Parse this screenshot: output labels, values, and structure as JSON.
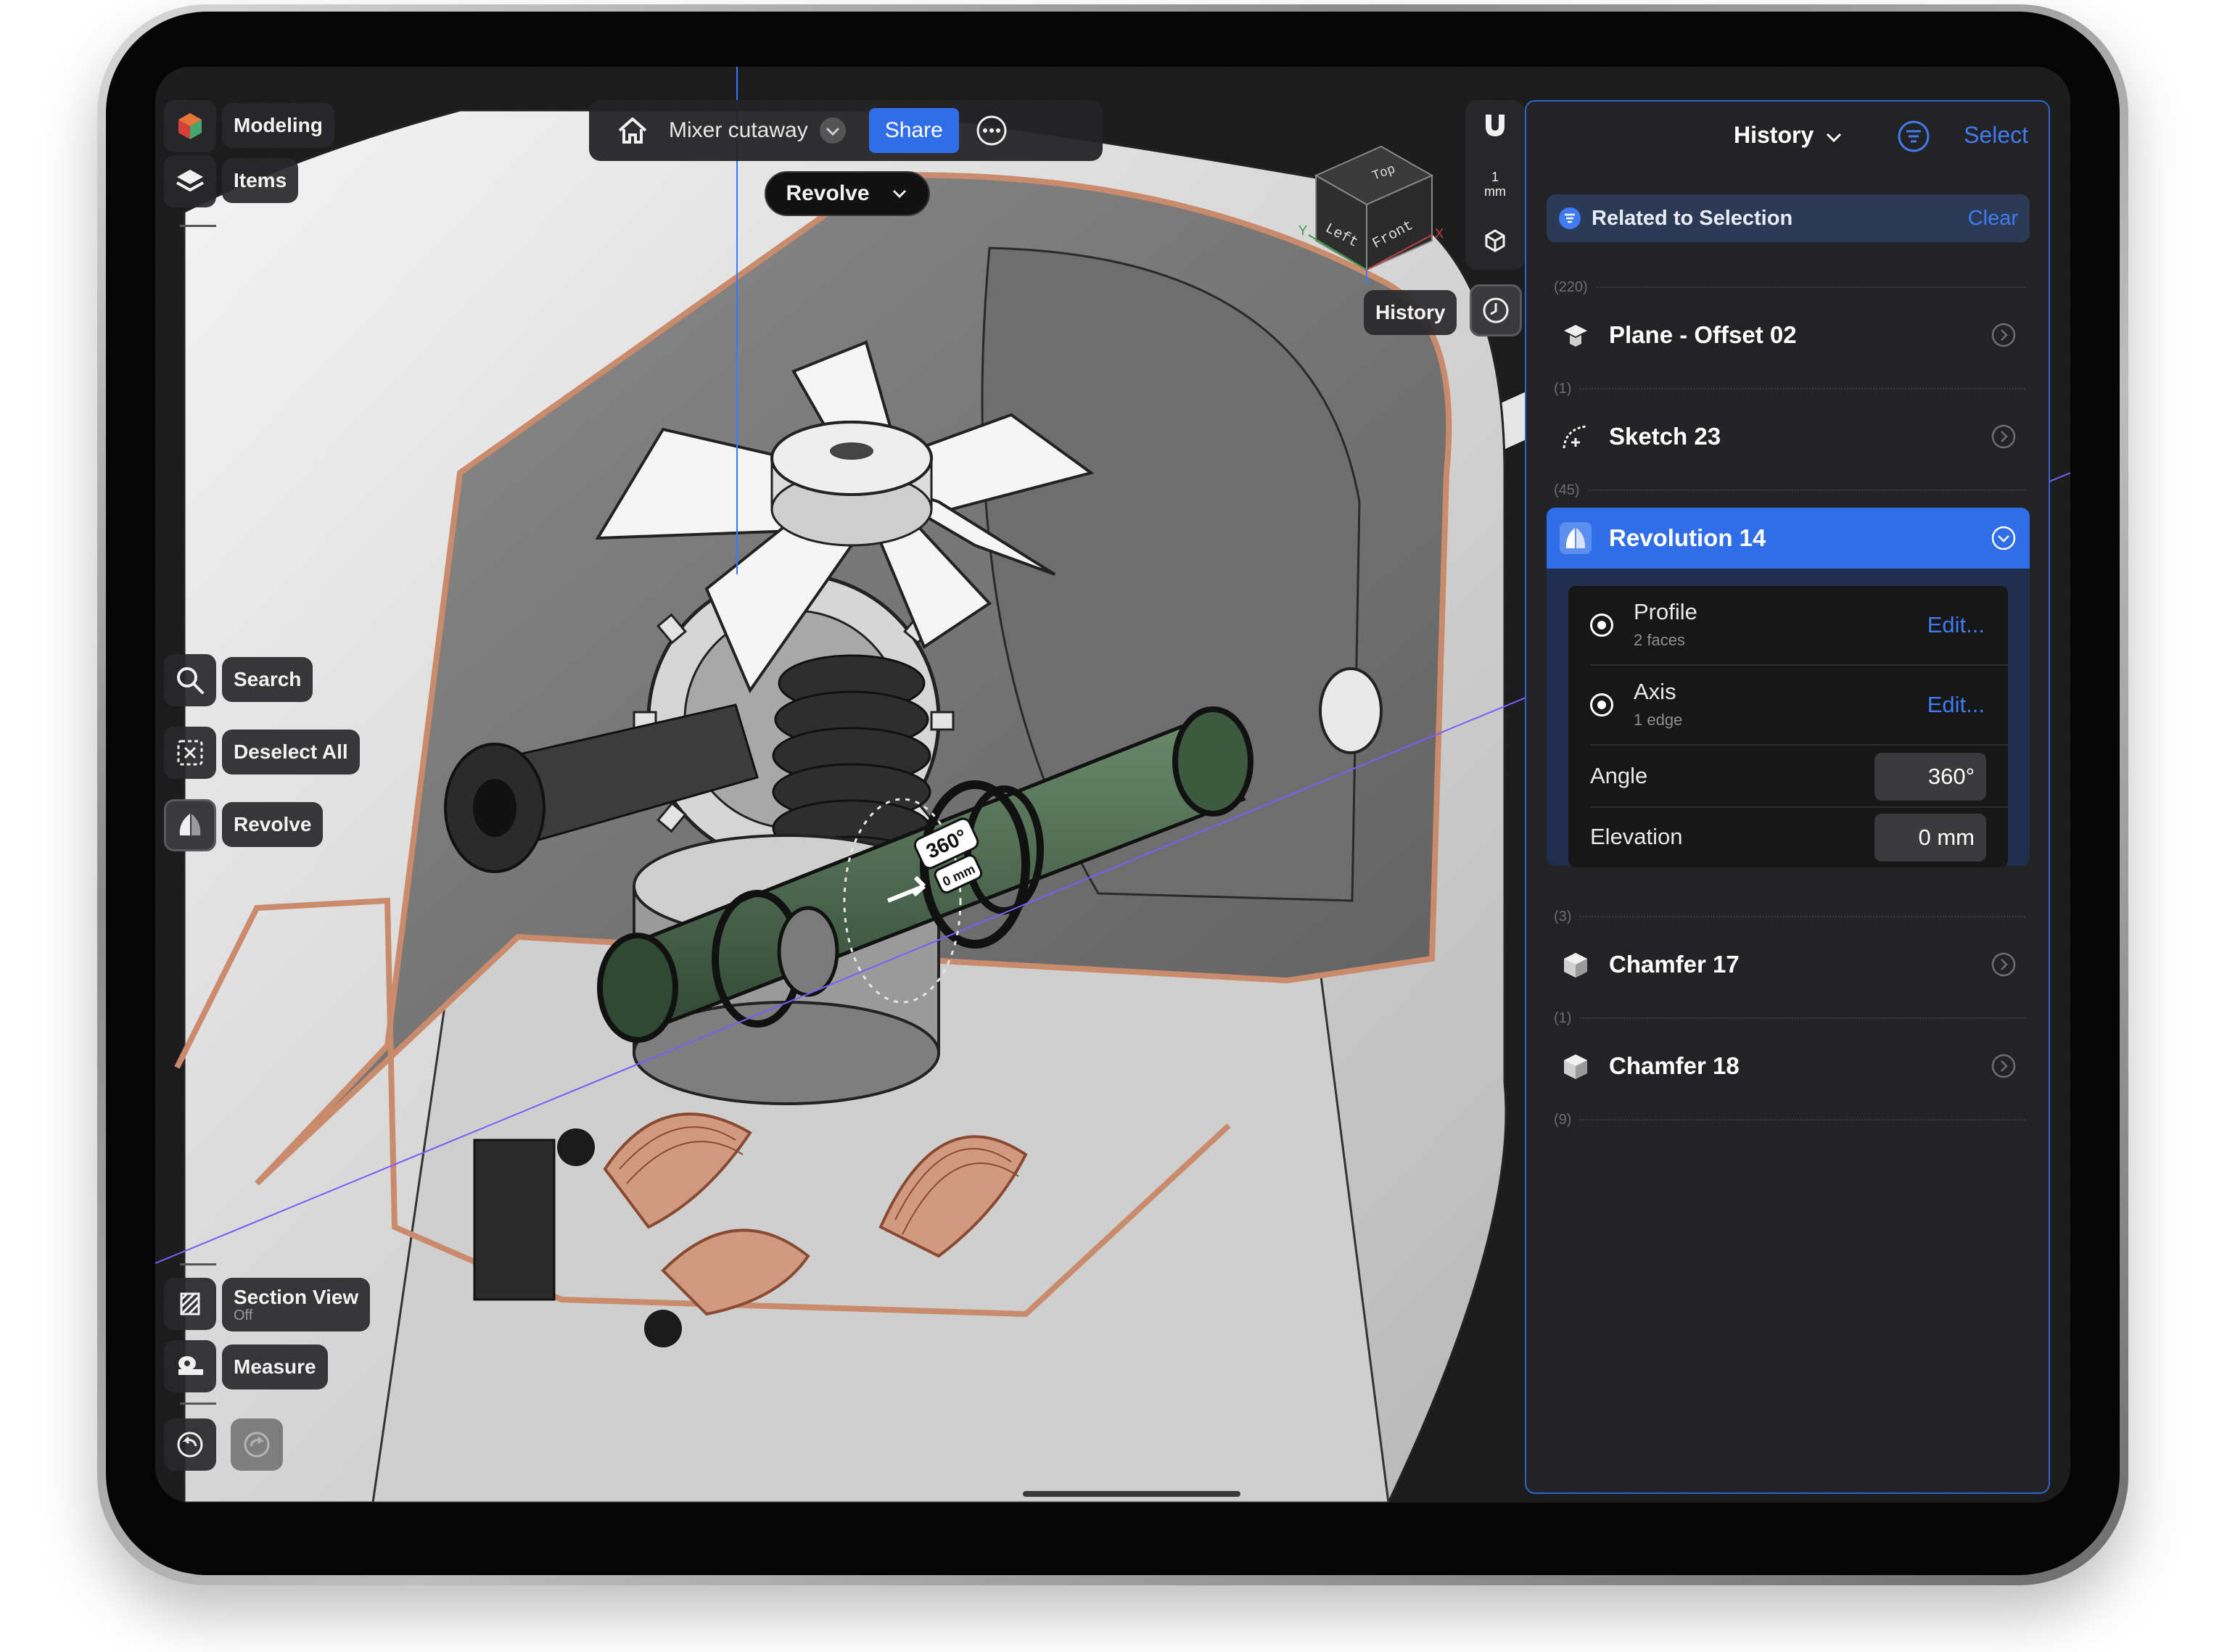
{
  "toolbar_left": {
    "modeling_label": "Modeling",
    "items_label": "Items",
    "search_label": "Search",
    "deselect_label": "Deselect All",
    "revolve_label": "Revolve",
    "section_label": "Section View",
    "section_state": "Off",
    "measure_label": "Measure"
  },
  "topbar": {
    "document_title": "Mixer cutaway",
    "share_label": "Share",
    "active_tool": "Revolve"
  },
  "right_tools": {
    "scale_value": "1",
    "scale_unit": "mm",
    "history_label": "History"
  },
  "viewcube": {
    "top": "Top",
    "left": "Left",
    "front": "Front",
    "axis_x": "X",
    "axis_y": "Y"
  },
  "gizmo": {
    "angle": "360°",
    "distance": "0 mm"
  },
  "panel": {
    "title": "History",
    "select_label": "Select",
    "related_label": "Related to Selection",
    "clear_label": "Clear",
    "counts": [
      "(220)",
      "(1)",
      "(45)",
      "(3)",
      "(1)",
      "(9)"
    ],
    "items": [
      {
        "label": "Plane - Offset 02",
        "icon": "plane-icon"
      },
      {
        "label": "Sketch 23",
        "icon": "sketch-icon"
      },
      {
        "label": "Revolution 14",
        "icon": "revolve-icon"
      },
      {
        "label": "Chamfer 17",
        "icon": "chamfer-icon"
      },
      {
        "label": "Chamfer 18",
        "icon": "chamfer-icon"
      }
    ],
    "revolution": {
      "profile_label": "Profile",
      "profile_sub": "2 faces",
      "axis_label": "Axis",
      "axis_sub": "1 edge",
      "edit_label": "Edit...",
      "angle_label": "Angle",
      "angle_value": "360°",
      "elevation_label": "Elevation",
      "elevation_value": "0 mm"
    }
  },
  "colors": {
    "accent": "#2f6ee8",
    "copper": "#c98b6b",
    "selection_green": "#4f6e52",
    "background": "#1c1c1c"
  }
}
